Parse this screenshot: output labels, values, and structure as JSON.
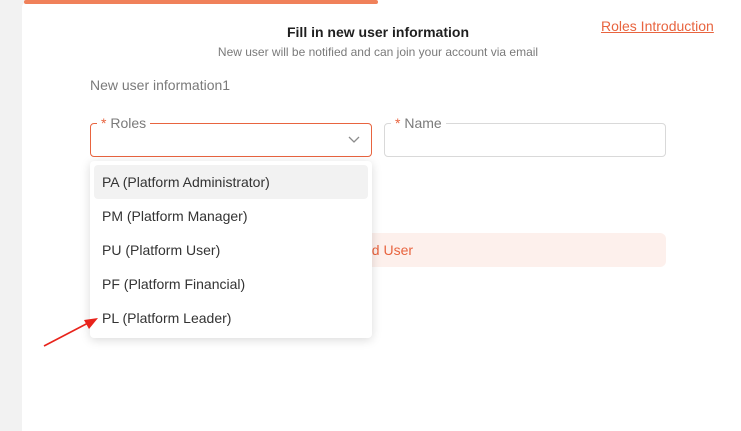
{
  "header": {
    "title": "Fill in new user information",
    "subtitle": "New user will be notified and can join your account via email",
    "roles_link": "Roles Introduction"
  },
  "form": {
    "section_label": "New user information1",
    "roles_label": "Roles",
    "name_label": "Name",
    "required_mark": "*",
    "add_user_label": "dd User"
  },
  "dropdown": {
    "options": [
      "PA (Platform Administrator)",
      "PM (Platform Manager)",
      "PU (Platform User)",
      "PF (Platform Financial)",
      "PL (Platform Leader)"
    ],
    "hovered_index": 0
  },
  "colors": {
    "accent": "#e8643f",
    "annotation_arrow": "#e8231b"
  },
  "icons": {
    "roles_dropdown": "chevron-down-icon"
  }
}
